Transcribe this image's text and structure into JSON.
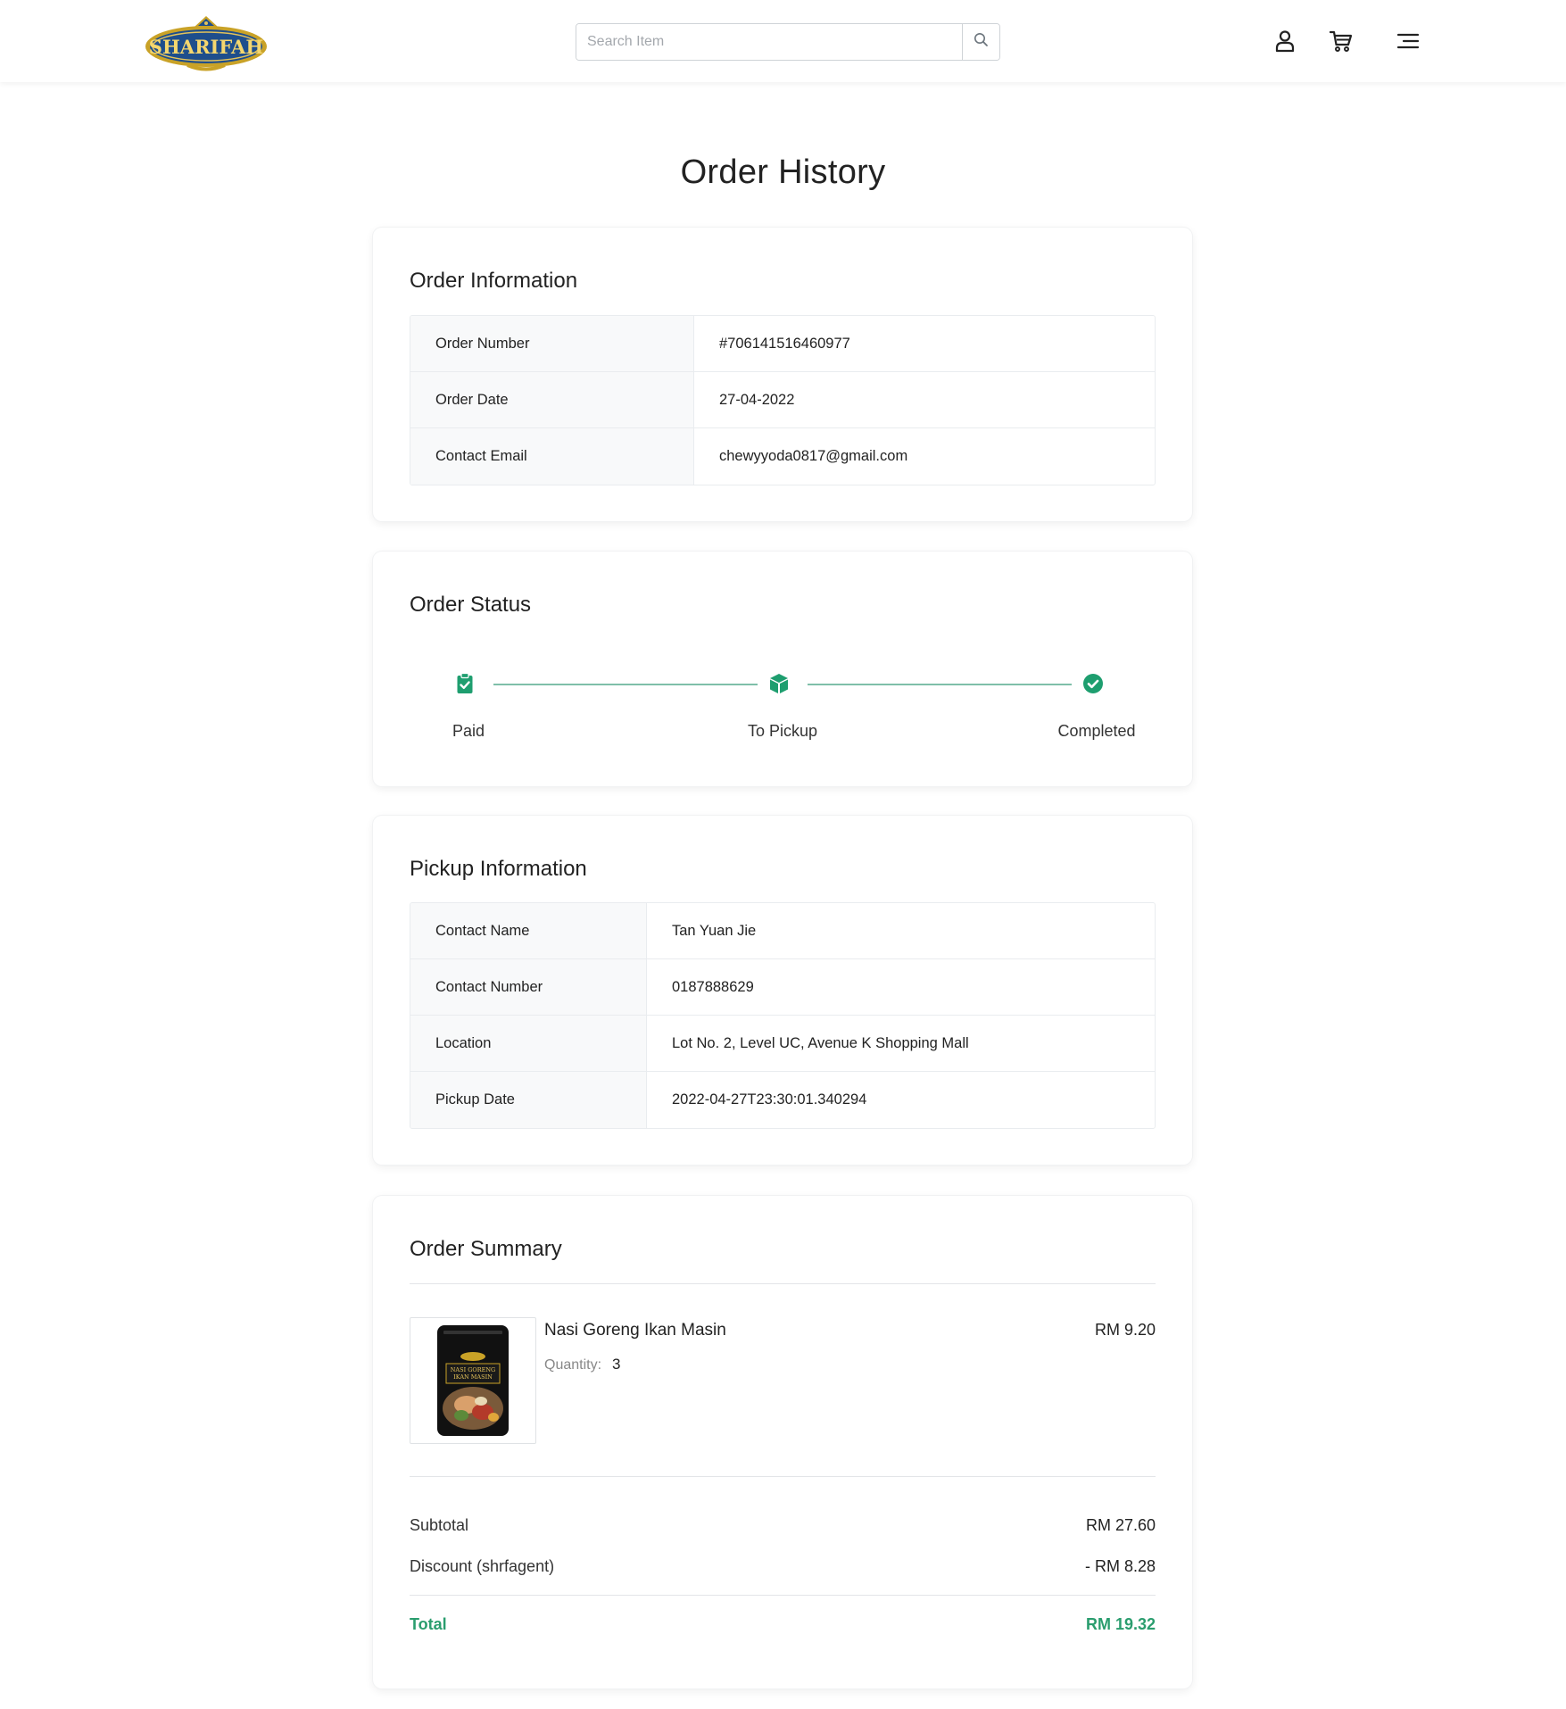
{
  "header": {
    "logo_text": "SHARIFAH",
    "search_placeholder": "Search Item",
    "icons": [
      "user-icon",
      "cart-icon",
      "menu-icon",
      "search-icon"
    ]
  },
  "page_title": "Order History",
  "order_information": {
    "title": "Order Information",
    "rows": [
      {
        "label": "Order Number",
        "value": "#706141516460977"
      },
      {
        "label": "Order Date",
        "value": "27-04-2022"
      },
      {
        "label": "Contact Email",
        "value": "chewyyoda0817@gmail.com"
      }
    ]
  },
  "order_status": {
    "title": "Order Status",
    "accent_color": "#1e9e6f",
    "steps": [
      {
        "label": "Paid",
        "icon": "clipboard-check-icon"
      },
      {
        "label": "To Pickup",
        "icon": "box-icon"
      },
      {
        "label": "Completed",
        "icon": "check-circle-icon"
      }
    ]
  },
  "pickup_information": {
    "title": "Pickup Information",
    "rows": [
      {
        "label": "Contact Name",
        "value": "Tan Yuan Jie"
      },
      {
        "label": "Contact Number",
        "value": "0187888629"
      },
      {
        "label": "Location",
        "value": "Lot No. 2, Level UC, Avenue K Shopping Mall"
      },
      {
        "label": "Pickup Date",
        "value": "2022-04-27T23:30:01.340294"
      }
    ]
  },
  "order_summary": {
    "title": "Order Summary",
    "items": [
      {
        "name": "Nasi Goreng Ikan Masin",
        "quantity_label": "Quantity:",
        "quantity": "3",
        "price": "RM 9.20",
        "image_text": "NASI GORENG IKAN MASIN"
      }
    ],
    "subtotal_label": "Subtotal",
    "subtotal_value": "RM 27.60",
    "discount_label": "Discount (shrfagent)",
    "discount_value": "- RM 8.28",
    "total_label": "Total",
    "total_value": "RM 19.32",
    "total_color": "#2a9d6e"
  }
}
